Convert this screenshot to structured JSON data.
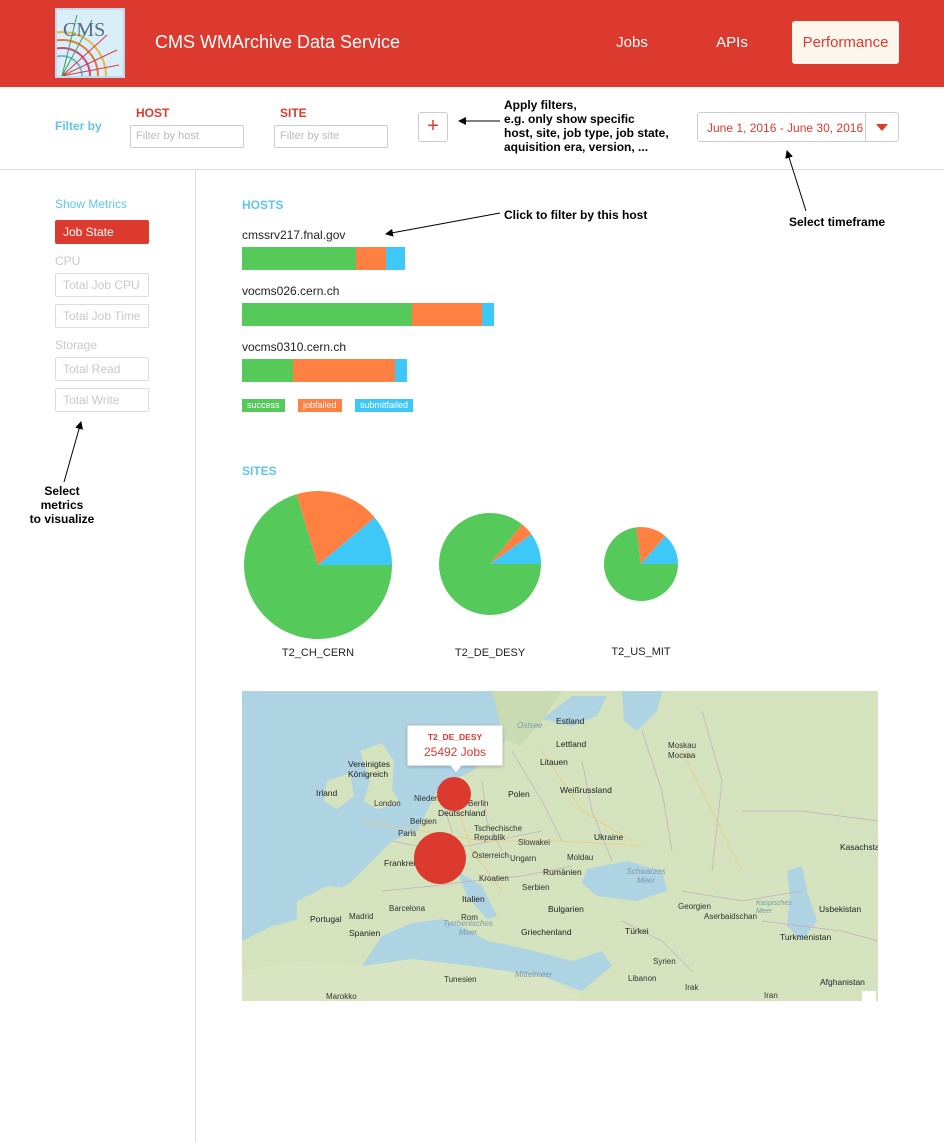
{
  "header": {
    "app_title": "CMS WMArchive Data Service",
    "logo_text": "CMS",
    "nav": [
      "Jobs",
      "APIs",
      "Performance"
    ],
    "active_nav": "Performance",
    "brand_color": "#dc3a2e"
  },
  "filters": {
    "filter_by_label": "Filter by",
    "host": {
      "label": "HOST",
      "placeholder": "Filter by host"
    },
    "site": {
      "label": "SITE",
      "placeholder": "Filter by site"
    },
    "add_icon": "plus-icon",
    "timeframe": "June 1, 2016 - June 30, 2016"
  },
  "annotations": {
    "apply_filters": [
      "Apply filters,",
      "e.g. only show specific",
      "host, site, job type, job state,",
      "aquisition era, version, ..."
    ],
    "click_host": "Click to filter by this host",
    "select_timeframe": "Select timeframe",
    "select_metrics": [
      "Select metrics",
      "to visualize"
    ]
  },
  "sidebar": {
    "title": "Show Metrics",
    "job_state": "Job State",
    "cpu_group": "CPU",
    "cpu_items": [
      "Total Job CPU",
      "Total Job Time"
    ],
    "storage_group": "Storage",
    "storage_items": [
      "Total Read",
      "Total Write"
    ]
  },
  "hosts": {
    "title": "HOSTS",
    "items": [
      {
        "name": "cmssrv217.fnal.gov",
        "success": 114,
        "jobfailed": 30,
        "submitfailed": 19
      },
      {
        "name": "vocms026.cern.ch",
        "success": 170,
        "jobfailed": 70,
        "submitfailed": 12
      },
      {
        "name": "vocms0310.cern.ch",
        "success": 51,
        "jobfailed": 102,
        "submitfailed": 12
      }
    ],
    "legend": [
      "success",
      "jobfailed",
      "submitfailed"
    ],
    "colors": {
      "success": "#55c95a",
      "jobfailed": "#ff8040",
      "submitfailed": "#3ec8f8"
    }
  },
  "sites": {
    "title": "SITES",
    "items": [
      {
        "name": "T2_CH_CERN",
        "success": 0.703,
        "jobfailed": 0.186,
        "submitfailed": 0.111
      },
      {
        "name": "T2_DE_DESY",
        "success": 0.859,
        "jobfailed": 0.042,
        "submitfailed": 0.099
      },
      {
        "name": "T2_US_MIT",
        "success": 0.73,
        "jobfailed": 0.134,
        "submitfailed": 0.136
      }
    ]
  },
  "map": {
    "tooltip": {
      "site": "T2_DE_DESY",
      "jobs": "25492 Jobs"
    },
    "labels": [
      "Ostsee",
      "Estland",
      "Lettland",
      "Litauen",
      "Moskau",
      "Москва",
      "Vereinigtes",
      "Königreich",
      "Irland",
      "London",
      "Niederlande",
      "Berlin",
      "Polen",
      "Weißrussland",
      "Deutschland",
      "Belgien",
      "Paris",
      "Tschechische Republik",
      "Slowakei",
      "Ukraine",
      "Österreich",
      "Ungarn",
      "Moldau",
      "Frankreich",
      "Kroatien",
      "Rumänien",
      "Kasachstan",
      "Serbien",
      "Italien",
      "Schwarzes Meer",
      "Bulgarien",
      "Georgien",
      "Usbekistan",
      "Portugal",
      "Madrid",
      "Spanien",
      "Barcelona",
      "Rom",
      "Tyrrhenisches Meer",
      "Griechenland",
      "Türkei",
      "Aserbaidschan",
      "Turkmenistan",
      "Kaspisches Meer",
      "Syrien",
      "Libanon",
      "Tunesien",
      "Mittelmeer",
      "Irak",
      "Iran",
      "Afghanistan",
      "Marokko"
    ]
  }
}
